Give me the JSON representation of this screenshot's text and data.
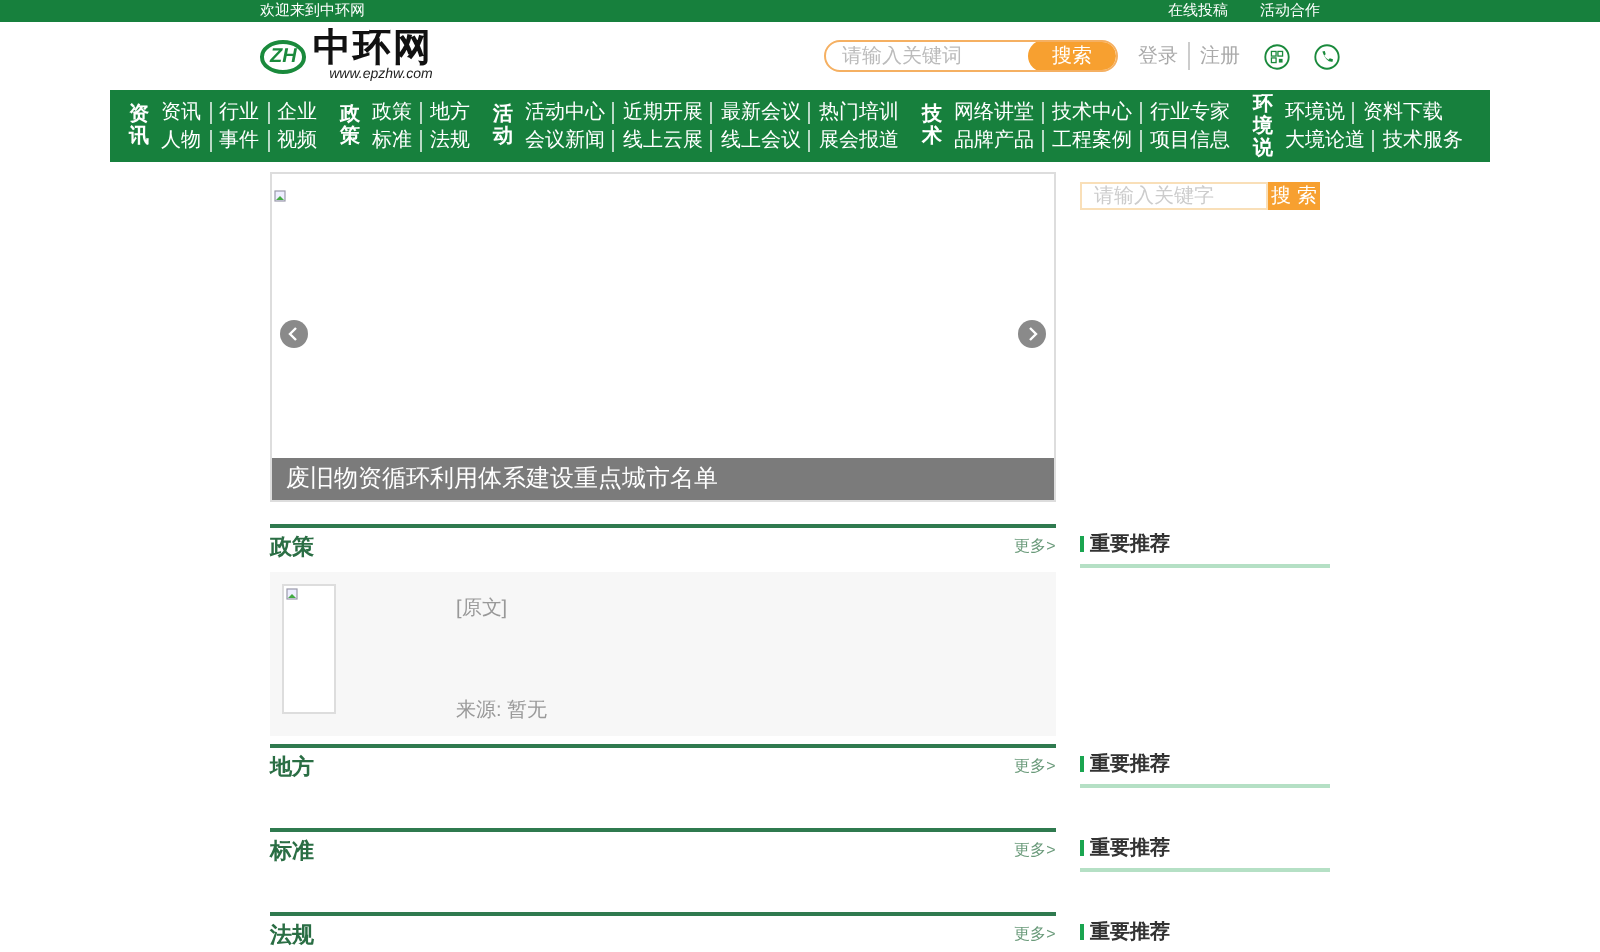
{
  "top_bar": {
    "welcome": "欢迎来到中环网",
    "links": [
      "在线投稿",
      "活动合作"
    ]
  },
  "header": {
    "logo_badge": "ZH",
    "logo_text": "中环网",
    "logo_url": "www.epzhw.com",
    "search": {
      "placeholder": "请输入关键词",
      "button": "搜索"
    },
    "account_links": [
      "登录",
      "注册"
    ]
  },
  "nav": [
    {
      "title": "资讯",
      "rows": [
        [
          "资讯",
          "行业",
          "企业"
        ],
        [
          "人物",
          "事件",
          "视频"
        ]
      ]
    },
    {
      "title": "政策",
      "rows": [
        [
          "政策",
          "地方"
        ],
        [
          "标准",
          "法规"
        ]
      ]
    },
    {
      "title": "活动",
      "rows": [
        [
          "活动中心",
          "近期开展",
          "最新会议",
          "热门培训"
        ],
        [
          "会议新闻",
          "线上云展",
          "线上会议",
          "展会报道"
        ]
      ]
    },
    {
      "title": "技术",
      "rows": [
        [
          "网络讲堂",
          "技术中心",
          "行业专家"
        ],
        [
          "品牌产品",
          "工程案例",
          "项目信息"
        ]
      ]
    },
    {
      "title": "环境说",
      "rows": [
        [
          "环境说",
          "资料下载"
        ],
        [
          "大境论道",
          "技术服务"
        ]
      ]
    }
  ],
  "slider": {
    "caption": "废旧物资循环利用体系建设重点城市名单"
  },
  "sections": [
    {
      "title": "政策",
      "more": "更多>",
      "items": [
        {
          "link": "[原文]",
          "source_label": "来源:",
          "source": "暂无"
        }
      ]
    },
    {
      "title": "地方",
      "more": "更多>"
    },
    {
      "title": "标准",
      "more": "更多>"
    },
    {
      "title": "法规",
      "more": "更多>"
    }
  ],
  "sidebar": {
    "search": {
      "placeholder": "请输入关键字",
      "button": "搜 索"
    },
    "panels": [
      "重要推荐",
      "重要推荐",
      "重要推荐",
      "重要推荐"
    ]
  }
}
